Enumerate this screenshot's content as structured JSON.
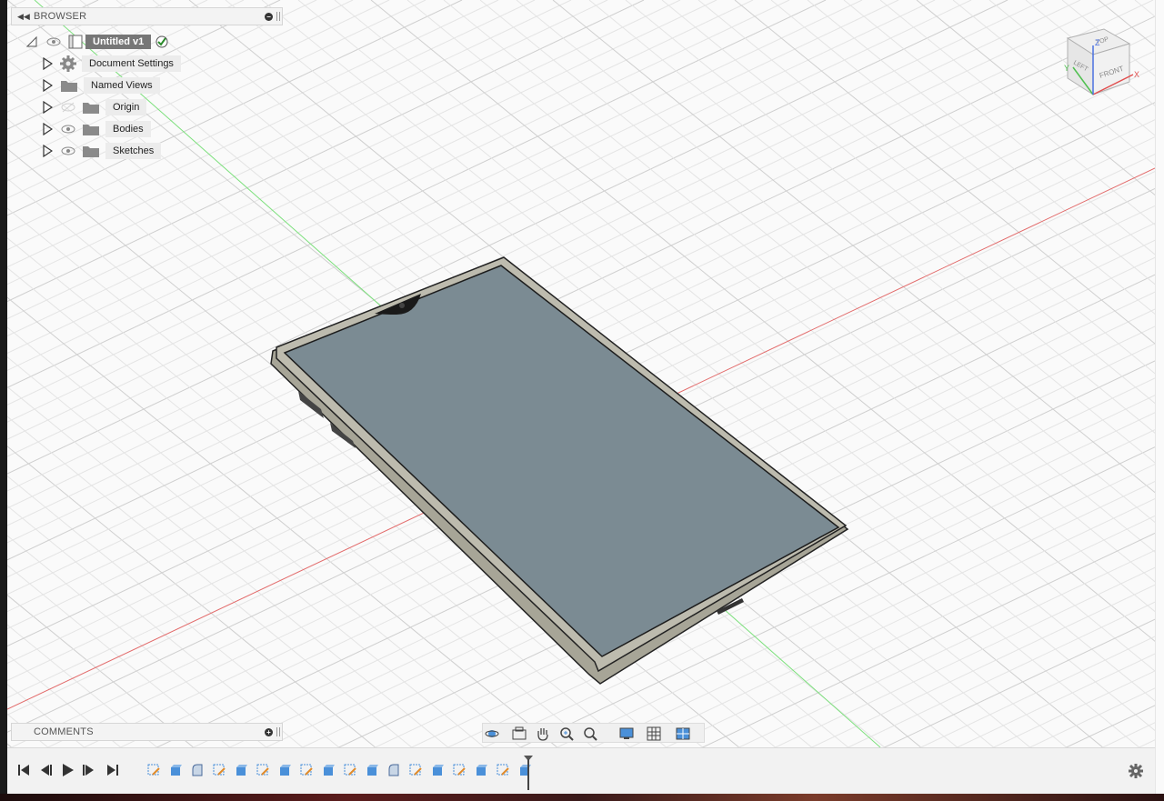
{
  "browser": {
    "header_label": "BROWSER",
    "root": {
      "name": "Untitled v1"
    },
    "items": [
      {
        "label": "Document Settings",
        "icon": "gear-icon",
        "visible": null
      },
      {
        "label": "Named Views",
        "icon": "folder-icon",
        "visible": null
      },
      {
        "label": "Origin",
        "icon": "folder-icon",
        "visible": false
      },
      {
        "label": "Bodies",
        "icon": "folder-icon",
        "visible": true
      },
      {
        "label": "Sketches",
        "icon": "folder-icon",
        "visible": true
      }
    ]
  },
  "comments": {
    "header_label": "COMMENTS"
  },
  "viewcube": {
    "top": "TOP",
    "left": "LEFT",
    "front": "FRONT",
    "axis_x": "X",
    "axis_y": "Y",
    "axis_z": "Z"
  },
  "nav_toolbar": [
    "orbit-icon",
    "look-at-icon",
    "pan-icon",
    "zoom-icon",
    "zoom-window-icon",
    "display-settings-icon",
    "grid-settings-icon",
    "viewports-icon"
  ],
  "timeline": {
    "playback": [
      "first-frame-icon",
      "previous-step-icon",
      "play-icon",
      "next-step-icon",
      "last-frame-icon"
    ],
    "features": [
      "sketch",
      "extrude",
      "fillet",
      "sketch",
      "extrude",
      "sketch",
      "extrude",
      "sketch",
      "extrude",
      "sketch",
      "extrude",
      "fillet",
      "sketch",
      "extrude",
      "sketch",
      "extrude",
      "sketch",
      "extrude"
    ]
  },
  "colors": {
    "accent": "#4a90d9",
    "axis_x": "#e05050",
    "axis_y": "#5ad35a",
    "screen": "#7a8a93",
    "body": "#a8a79a"
  }
}
